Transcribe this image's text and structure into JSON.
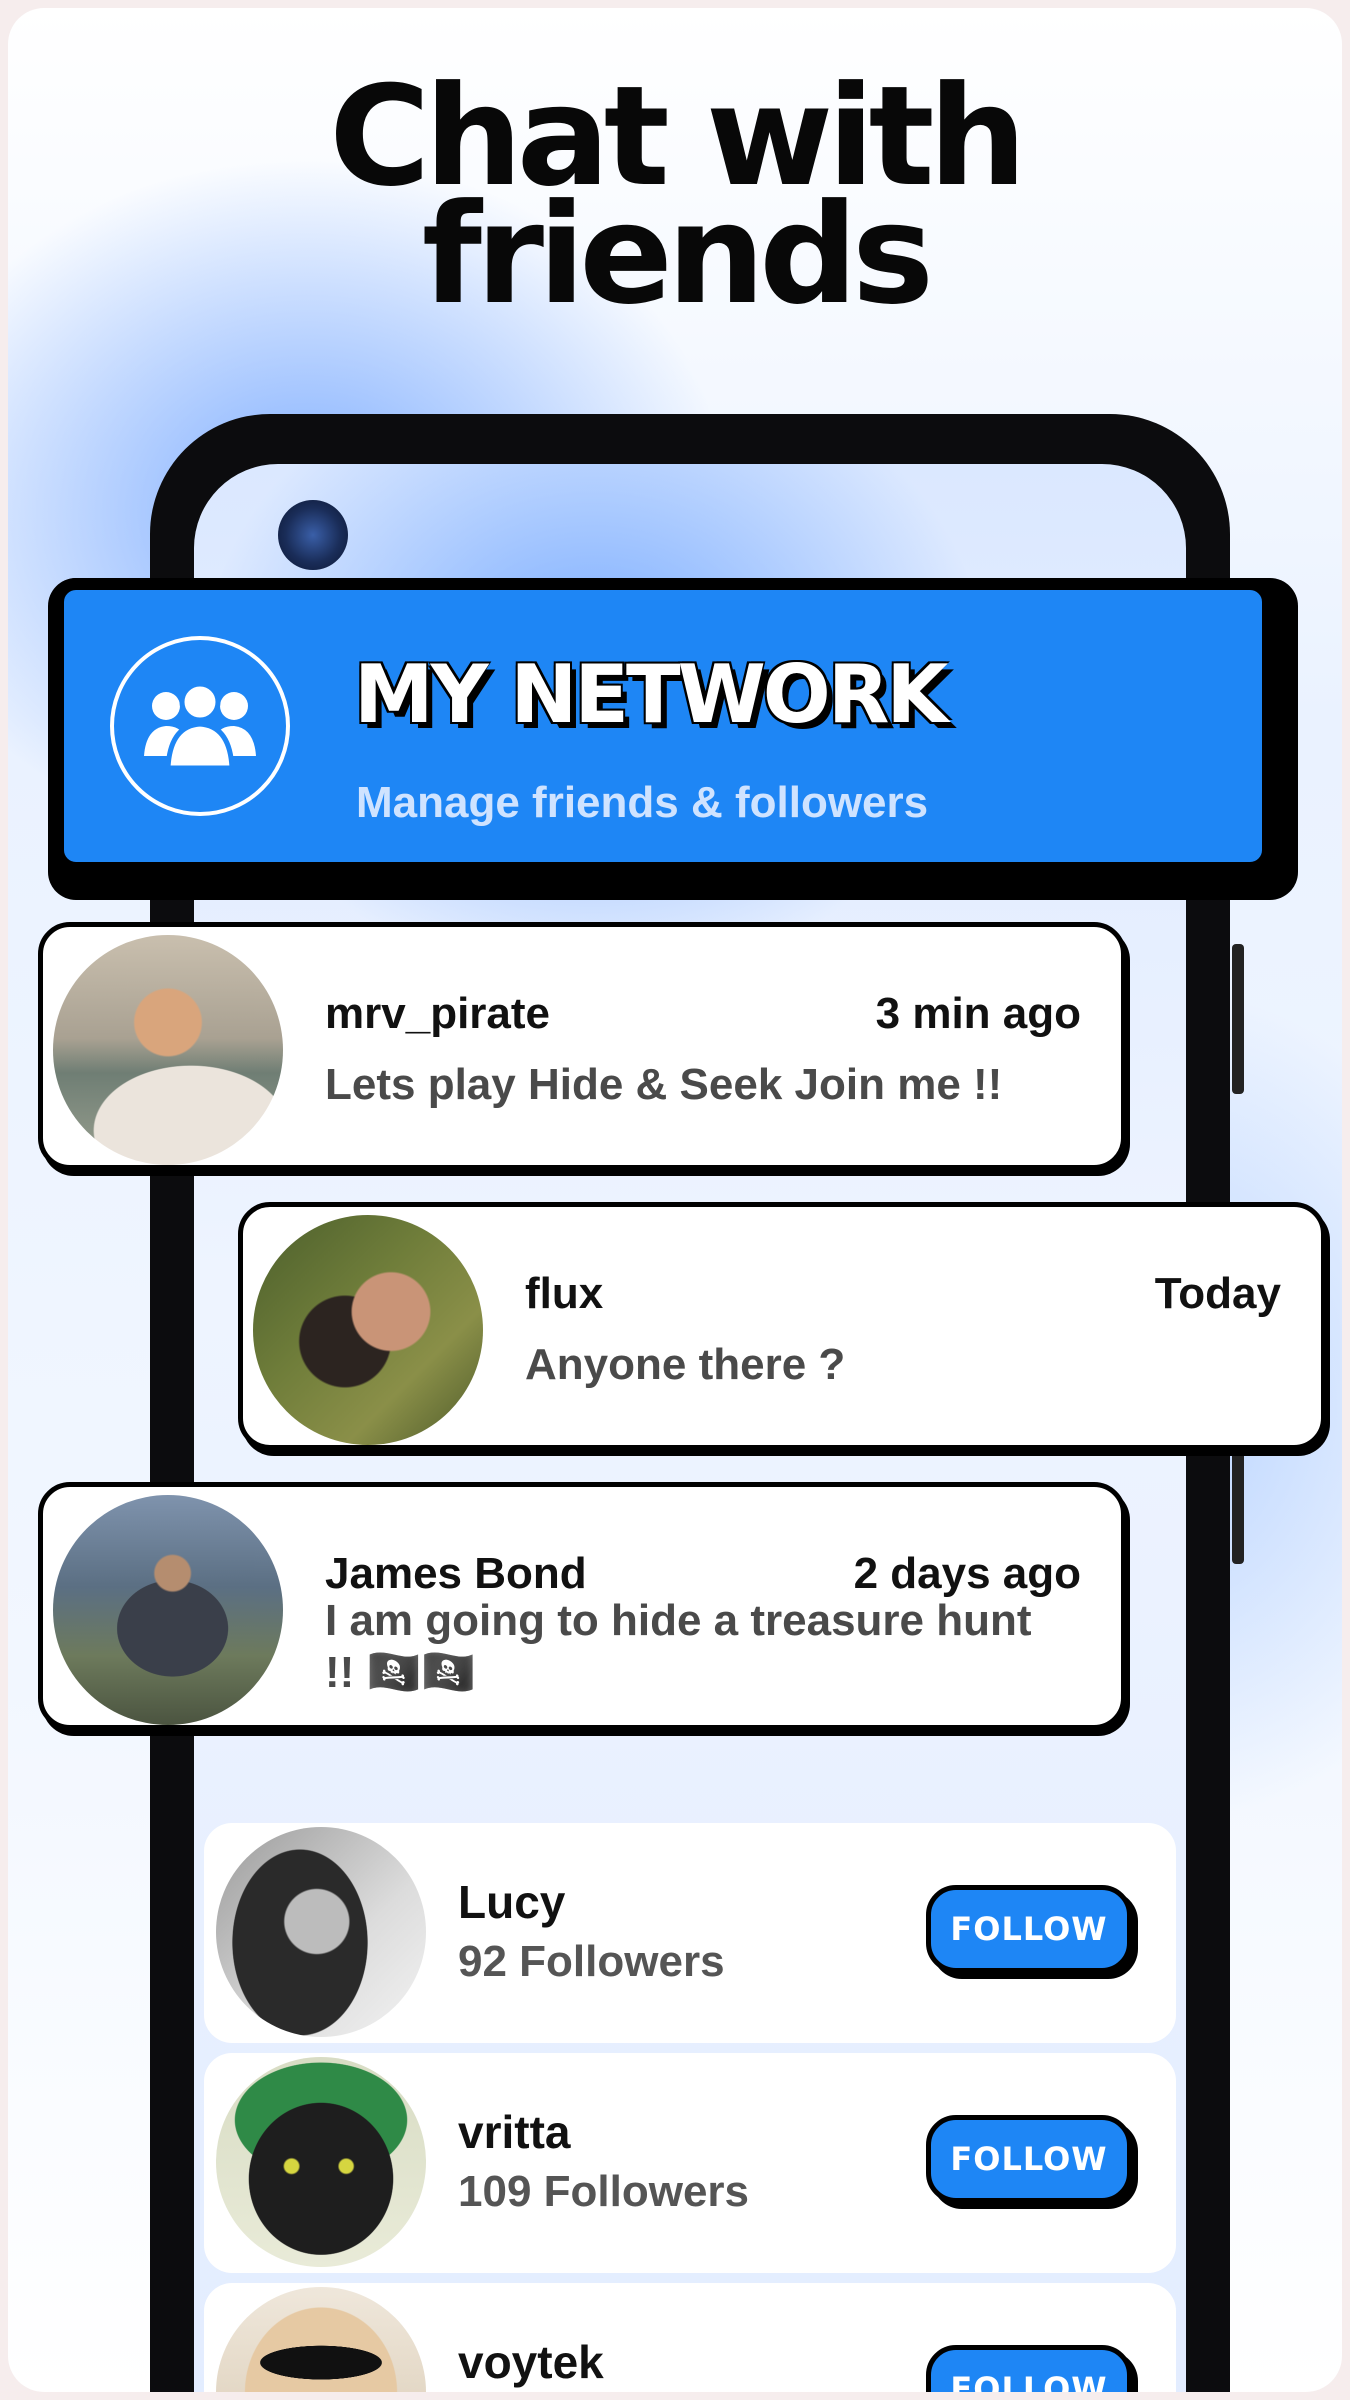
{
  "headline": {
    "line1": "Chat with",
    "line2": "friends"
  },
  "banner": {
    "title": "MY NETWORK",
    "subtitle": "Manage friends & followers",
    "icon": "group-icon"
  },
  "messages": [
    {
      "name": "mrv_pirate",
      "time": "3 min ago",
      "text": "Lets play Hide & Seek Join me !!"
    },
    {
      "name": "flux",
      "time": "Today",
      "text": "Anyone there ?"
    },
    {
      "name": "James Bond",
      "time": "2 days ago",
      "text": "I am going to hide a treasure hunt !! 🏴‍☠️🏴‍☠️"
    }
  ],
  "suggestions": [
    {
      "name": "Lucy",
      "followers": "92 Followers",
      "button": "FOLLOW"
    },
    {
      "name": "vritta",
      "followers": "109 Followers",
      "button": "FOLLOW"
    },
    {
      "name": "voytek",
      "followers": "",
      "button": "FOLLOW"
    }
  ],
  "colors": {
    "accent": "#1e86f5",
    "ink": "#000000"
  }
}
